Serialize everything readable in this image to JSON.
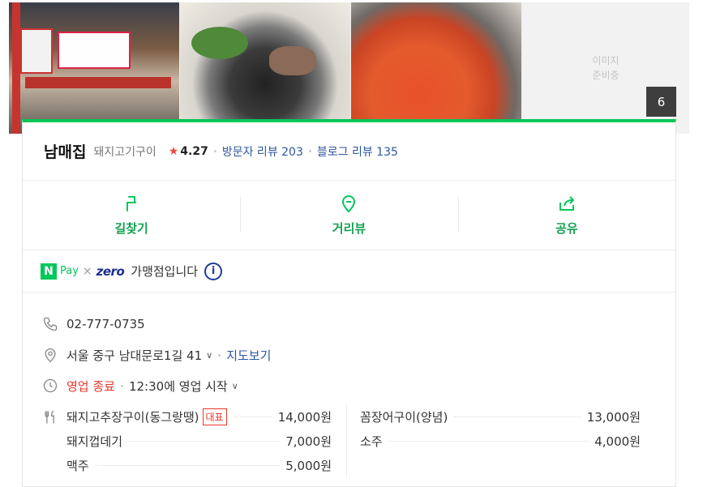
{
  "photos": {
    "no_image_line1": "이미지",
    "no_image_line2": "준비중",
    "count": "6"
  },
  "place": {
    "name": "남매집",
    "category": "돼지고기구이",
    "rating": "4.27",
    "visitor_reviews": "방문자 리뷰 203",
    "blog_reviews": "블로그 리뷰 135"
  },
  "actions": [
    {
      "label": "길찾기",
      "icon": "directions-icon"
    },
    {
      "label": "거리뷰",
      "icon": "street-view-icon"
    },
    {
      "label": "공유",
      "icon": "share-icon"
    }
  ],
  "npay": {
    "n": "N",
    "pay": "Pay",
    "times": "×",
    "zero": "zero",
    "text": "가맹점입니다",
    "info": "i"
  },
  "info": {
    "phone": "02-777-0735",
    "address": "서울 중구 남대문로1길 41",
    "map_link": "지도보기",
    "status": "영업 종료",
    "hours": "12:30에 영업 시작"
  },
  "menu": {
    "left": [
      {
        "name": "돼지고추장구이(동그랑땡)",
        "badge": "대표",
        "price": "14,000원"
      },
      {
        "name": "돼지껍데기",
        "price": "7,000원"
      },
      {
        "name": "맥주",
        "price": "5,000원"
      }
    ],
    "right": [
      {
        "name": "꼼장어구이(양념)",
        "price": "13,000원"
      },
      {
        "name": "소주",
        "price": "4,000원"
      }
    ]
  },
  "colors": {
    "accent_green": "#03c75a",
    "link_blue": "#2d56a1",
    "closed_red": "#e8382c",
    "star_red": "#f0483e"
  }
}
